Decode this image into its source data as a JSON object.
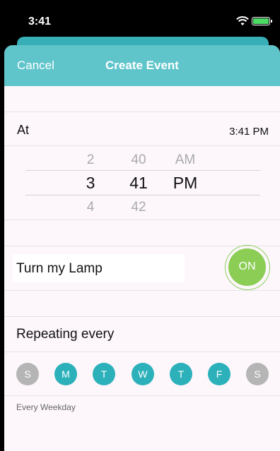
{
  "status_bar": {
    "time": "3:41"
  },
  "nav": {
    "cancel_label": "Cancel",
    "title": "Create Event"
  },
  "at": {
    "label": "At",
    "time_value": "3:41 PM"
  },
  "picker": {
    "hours": [
      "2",
      "3",
      "4"
    ],
    "minutes": [
      "40",
      "41",
      "42"
    ],
    "periods": [
      "AM",
      "PM"
    ]
  },
  "lamp": {
    "label": "Turn my Lamp",
    "toggle_label": "ON"
  },
  "repeat": {
    "label": "Repeating every",
    "days": [
      {
        "label": "S",
        "selected": false
      },
      {
        "label": "M",
        "selected": true
      },
      {
        "label": "T",
        "selected": true
      },
      {
        "label": "W",
        "selected": true
      },
      {
        "label": "T",
        "selected": true
      },
      {
        "label": "F",
        "selected": true
      },
      {
        "label": "S",
        "selected": false
      }
    ],
    "summary": "Every Weekday"
  },
  "colors": {
    "accent": "#5fc5cb",
    "day_selected": "#2cb0ba",
    "day_unselected": "#b5b5b5",
    "toggle_on": "#8bcd55"
  }
}
